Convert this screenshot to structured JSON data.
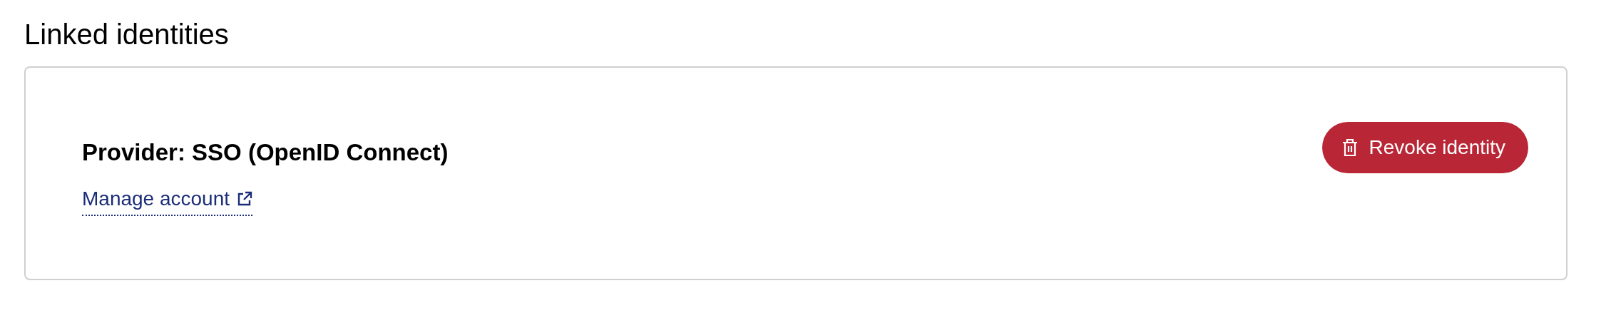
{
  "heading": "Linked identities",
  "identities": [
    {
      "provider": "Provider: SSO (OpenID Connect)",
      "link": "Manage account",
      "action": "Revoke identity"
    }
  ]
}
